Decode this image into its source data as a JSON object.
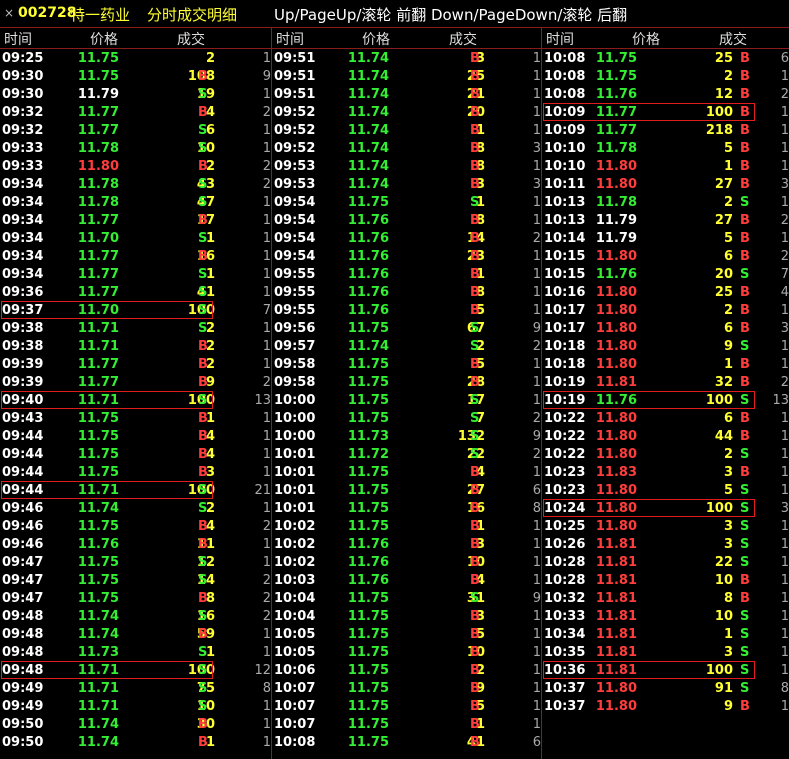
{
  "title": {
    "close": "×",
    "code": "002728",
    "name": "特一药业",
    "subtitle": "分时成交明细",
    "hint": "Up/PageUp/滚轮 前翻 Down/PageDown/滚轮 后翻"
  },
  "headers": {
    "time": "时间",
    "price": "价格",
    "volume": "成交"
  },
  "columns": [
    [
      [
        "09:25",
        "11.75",
        "2",
        "",
        "1"
      ],
      [
        "09:30",
        "11.75",
        "108",
        "B",
        "9"
      ],
      [
        "09:30",
        "11.79",
        "19",
        "S",
        "1"
      ],
      [
        "09:32",
        "11.77",
        "4",
        "B",
        "2"
      ],
      [
        "09:32",
        "11.77",
        "6",
        "S",
        "1"
      ],
      [
        "09:33",
        "11.78",
        "10",
        "S",
        "1"
      ],
      [
        "09:33",
        "11.80",
        "2",
        "B",
        "2"
      ],
      [
        "09:34",
        "11.78",
        "43",
        "S",
        "2"
      ],
      [
        "09:34",
        "11.78",
        "47",
        "S",
        "1"
      ],
      [
        "09:34",
        "11.77",
        "17",
        "B",
        "1"
      ],
      [
        "09:34",
        "11.70",
        "1",
        "S",
        "1"
      ],
      [
        "09:34",
        "11.77",
        "16",
        "B",
        "1"
      ],
      [
        "09:34",
        "11.77",
        "1",
        "S",
        "1"
      ],
      [
        "09:36",
        "11.77",
        "41",
        "S",
        "1"
      ],
      [
        "09:37",
        "11.70",
        "100",
        "S",
        "7"
      ],
      [
        "09:38",
        "11.71",
        "2",
        "S",
        "1"
      ],
      [
        "09:38",
        "11.71",
        "2",
        "B",
        "1"
      ],
      [
        "09:39",
        "11.77",
        "2",
        "B",
        "1"
      ],
      [
        "09:39",
        "11.77",
        "9",
        "B",
        "2"
      ],
      [
        "09:40",
        "11.71",
        "100",
        "S",
        "13"
      ],
      [
        "09:43",
        "11.75",
        "1",
        "B",
        "1"
      ],
      [
        "09:44",
        "11.75",
        "4",
        "B",
        "1"
      ],
      [
        "09:44",
        "11.75",
        "4",
        "B",
        "1"
      ],
      [
        "09:44",
        "11.75",
        "3",
        "B",
        "1"
      ],
      [
        "09:44",
        "11.71",
        "100",
        "S",
        "21"
      ],
      [
        "09:46",
        "11.74",
        "2",
        "S",
        "1"
      ],
      [
        "09:46",
        "11.75",
        "4",
        "B",
        "2"
      ],
      [
        "09:46",
        "11.76",
        "11",
        "B",
        "1"
      ],
      [
        "09:47",
        "11.75",
        "12",
        "S",
        "1"
      ],
      [
        "09:47",
        "11.75",
        "14",
        "S",
        "2"
      ],
      [
        "09:47",
        "11.75",
        "8",
        "B",
        "2"
      ],
      [
        "09:48",
        "11.74",
        "16",
        "S",
        "2"
      ],
      [
        "09:48",
        "11.74",
        "59",
        "B",
        "1"
      ],
      [
        "09:48",
        "11.73",
        "1",
        "S",
        "1"
      ],
      [
        "09:48",
        "11.71",
        "100",
        "S",
        "12"
      ],
      [
        "09:49",
        "11.71",
        "75",
        "S",
        "8"
      ],
      [
        "09:49",
        "11.71",
        "10",
        "S",
        "1"
      ],
      [
        "09:50",
        "11.74",
        "30",
        "B",
        "1"
      ],
      [
        "09:50",
        "11.74",
        "1",
        "B",
        "1"
      ]
    ],
    [
      [
        "09:51",
        "11.74",
        "3",
        "B",
        "1"
      ],
      [
        "09:51",
        "11.74",
        "25",
        "B",
        "1"
      ],
      [
        "09:51",
        "11.74",
        "21",
        "B",
        "1"
      ],
      [
        "09:52",
        "11.74",
        "20",
        "B",
        "1"
      ],
      [
        "09:52",
        "11.74",
        "1",
        "B",
        "1"
      ],
      [
        "09:52",
        "11.74",
        "8",
        "B",
        "3"
      ],
      [
        "09:53",
        "11.74",
        "8",
        "B",
        "1"
      ],
      [
        "09:53",
        "11.74",
        "3",
        "B",
        "3"
      ],
      [
        "09:54",
        "11.75",
        "1",
        "S",
        "1"
      ],
      [
        "09:54",
        "11.76",
        "8",
        "B",
        "1"
      ],
      [
        "09:54",
        "11.76",
        "14",
        "B",
        "2"
      ],
      [
        "09:54",
        "11.76",
        "23",
        "B",
        "1"
      ],
      [
        "09:55",
        "11.76",
        "1",
        "B",
        "1"
      ],
      [
        "09:55",
        "11.76",
        "8",
        "B",
        "1"
      ],
      [
        "09:55",
        "11.76",
        "5",
        "B",
        "1"
      ],
      [
        "09:56",
        "11.75",
        "67",
        "S",
        "9"
      ],
      [
        "09:57",
        "11.74",
        "2",
        "S",
        "2"
      ],
      [
        "09:58",
        "11.75",
        "5",
        "B",
        "1"
      ],
      [
        "09:58",
        "11.75",
        "28",
        "B",
        "1"
      ],
      [
        "10:00",
        "11.75",
        "17",
        "S",
        "1"
      ],
      [
        "10:00",
        "11.75",
        "7",
        "S",
        "2"
      ],
      [
        "10:00",
        "11.73",
        "132",
        "S",
        "9"
      ],
      [
        "10:01",
        "11.72",
        "22",
        "S",
        "2"
      ],
      [
        "10:01",
        "11.75",
        "4",
        "B",
        "1"
      ],
      [
        "10:01",
        "11.75",
        "27",
        "B",
        "6"
      ],
      [
        "10:01",
        "11.75",
        "16",
        "B",
        "8"
      ],
      [
        "10:02",
        "11.75",
        "1",
        "B",
        "1"
      ],
      [
        "10:02",
        "11.76",
        "3",
        "B",
        "1"
      ],
      [
        "10:02",
        "11.76",
        "10",
        "B",
        "1"
      ],
      [
        "10:03",
        "11.76",
        "4",
        "B",
        "1"
      ],
      [
        "10:04",
        "11.75",
        "31",
        "S",
        "9"
      ],
      [
        "10:04",
        "11.75",
        "3",
        "B",
        "1"
      ],
      [
        "10:05",
        "11.75",
        "5",
        "B",
        "1"
      ],
      [
        "10:05",
        "11.75",
        "10",
        "B",
        "1"
      ],
      [
        "10:06",
        "11.75",
        "2",
        "B",
        "1"
      ],
      [
        "10:07",
        "11.75",
        "9",
        "B",
        "1"
      ],
      [
        "10:07",
        "11.75",
        "5",
        "B",
        "1"
      ],
      [
        "10:07",
        "11.75",
        "1",
        "B",
        "1"
      ],
      [
        "10:08",
        "11.75",
        "41",
        "B",
        "6"
      ]
    ],
    [
      [
        "10:08",
        "11.75",
        "25",
        "B",
        "6"
      ],
      [
        "10:08",
        "11.75",
        "2",
        "B",
        "1"
      ],
      [
        "10:08",
        "11.76",
        "12",
        "B",
        "2"
      ],
      [
        "10:09",
        "11.77",
        "100",
        "B",
        "1"
      ],
      [
        "10:09",
        "11.77",
        "218",
        "B",
        "1"
      ],
      [
        "10:10",
        "11.78",
        "5",
        "B",
        "1"
      ],
      [
        "10:10",
        "11.80",
        "1",
        "B",
        "1"
      ],
      [
        "10:11",
        "11.80",
        "27",
        "B",
        "3"
      ],
      [
        "10:13",
        "11.78",
        "2",
        "S",
        "1"
      ],
      [
        "10:13",
        "11.79",
        "27",
        "B",
        "2"
      ],
      [
        "10:14",
        "11.79",
        "5",
        "B",
        "1"
      ],
      [
        "10:15",
        "11.80",
        "6",
        "B",
        "2"
      ],
      [
        "10:15",
        "11.76",
        "20",
        "S",
        "7"
      ],
      [
        "10:16",
        "11.80",
        "25",
        "B",
        "4"
      ],
      [
        "10:17",
        "11.80",
        "2",
        "B",
        "1"
      ],
      [
        "10:17",
        "11.80",
        "6",
        "B",
        "3"
      ],
      [
        "10:18",
        "11.80",
        "9",
        "S",
        "1"
      ],
      [
        "10:18",
        "11.80",
        "1",
        "B",
        "1"
      ],
      [
        "10:19",
        "11.81",
        "32",
        "B",
        "2"
      ],
      [
        "10:19",
        "11.76",
        "100",
        "S",
        "13"
      ],
      [
        "10:22",
        "11.80",
        "6",
        "B",
        "1"
      ],
      [
        "10:22",
        "11.80",
        "44",
        "B",
        "1"
      ],
      [
        "10:22",
        "11.80",
        "2",
        "S",
        "1"
      ],
      [
        "10:23",
        "11.83",
        "3",
        "B",
        "1"
      ],
      [
        "10:23",
        "11.80",
        "5",
        "S",
        "1"
      ],
      [
        "10:24",
        "11.80",
        "100",
        "S",
        "3"
      ],
      [
        "10:25",
        "11.80",
        "3",
        "S",
        "1"
      ],
      [
        "10:26",
        "11.81",
        "3",
        "S",
        "1"
      ],
      [
        "10:28",
        "11.81",
        "22",
        "S",
        "1"
      ],
      [
        "10:28",
        "11.81",
        "10",
        "B",
        "1"
      ],
      [
        "10:32",
        "11.81",
        "8",
        "B",
        "1"
      ],
      [
        "10:33",
        "11.81",
        "10",
        "S",
        "1"
      ],
      [
        "10:34",
        "11.81",
        "1",
        "S",
        "1"
      ],
      [
        "10:35",
        "11.81",
        "3",
        "S",
        "1"
      ],
      [
        "10:36",
        "11.81",
        "100",
        "S",
        "1"
      ],
      [
        "10:37",
        "11.80",
        "91",
        "S",
        "8"
      ],
      [
        "10:37",
        "11.80",
        "9",
        "B",
        "1"
      ]
    ]
  ],
  "highlighted_rows": [
    [
      14,
      19,
      24,
      34
    ],
    [],
    [
      3,
      19,
      25,
      34
    ]
  ],
  "colors": {
    "up": "#ff3d3d",
    "down": "#33ee33",
    "flat": "#ffffff",
    "volume": "#ffff33",
    "buy": "#ff3d3d",
    "sell": "#33ee33",
    "highlight_border": "#e21b1b",
    "grid_line": "#8a1c1c"
  },
  "reference_price": "11.79"
}
